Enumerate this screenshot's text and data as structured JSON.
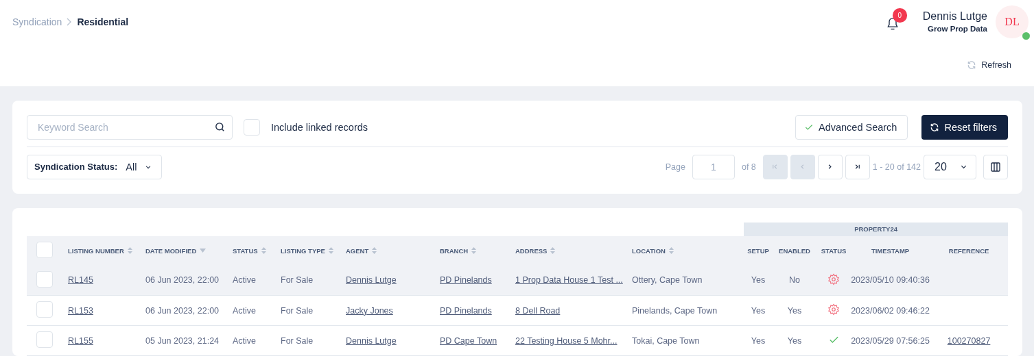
{
  "breadcrumb": [
    {
      "label": "Syndication",
      "current": false
    },
    {
      "label": "Residential",
      "current": true
    }
  ],
  "notifications": {
    "count": "0"
  },
  "user": {
    "name": "Dennis Lutge",
    "company": "Grow Prop Data",
    "initials": "DL",
    "online": true
  },
  "refresh": {
    "label": "Refresh"
  },
  "filters": {
    "search": {
      "placeholder": "Keyword Search"
    },
    "linked": {
      "label": "Include linked records",
      "checked": false
    },
    "advanced": {
      "label": "Advanced Search",
      "active": true
    },
    "reset": {
      "label": "Reset filters"
    },
    "status_filter": {
      "label": "Syndication Status:",
      "value": "All"
    }
  },
  "pagination": {
    "page_label": "Page",
    "page": "1",
    "of": "of 8",
    "buttons": [
      {
        "kind": "first",
        "disabled": true
      },
      {
        "kind": "prev",
        "disabled": true
      },
      {
        "kind": "next",
        "disabled": false
      },
      {
        "kind": "last",
        "disabled": false
      }
    ],
    "range": "1 - 20 of 142",
    "per_page": "20"
  },
  "table": {
    "group_header": "PROPERTY24",
    "all_checked": false,
    "columns": [
      {
        "label": "LISTING NUMBER",
        "sortable": true,
        "sorted": false
      },
      {
        "label": "DATE MODIFIED",
        "sortable": true,
        "sorted": true
      },
      {
        "label": "STATUS",
        "sortable": true,
        "sorted": false
      },
      {
        "label": "LISTING TYPE",
        "sortable": true,
        "sorted": false
      },
      {
        "label": "AGENT",
        "sortable": true,
        "sorted": false
      },
      {
        "label": "BRANCH",
        "sortable": true,
        "sorted": false
      },
      {
        "label": "ADDRESS",
        "sortable": true,
        "sorted": false
      },
      {
        "label": "LOCATION",
        "sortable": true,
        "sorted": false
      },
      {
        "label": "SETUP",
        "sortable": false
      },
      {
        "label": "ENABLED",
        "sortable": false
      },
      {
        "label": "STATUS",
        "sortable": false
      },
      {
        "label": "TIMESTAMP",
        "sortable": false
      },
      {
        "label": "REFERENCE",
        "sortable": false
      }
    ],
    "rows": [
      {
        "highlighted": true,
        "checked": false,
        "listing": "RL145",
        "date": "06 Jun 2023, 22:00",
        "status": "Active",
        "type": "For Sale",
        "agent": "Dennis Lutge",
        "branch": "PD Pinelands",
        "address": "1 Prop Data House 1 Test ...",
        "location": "Ottery, Cape Town",
        "setup": "Yes",
        "enabled": "No",
        "synced": false,
        "timestamp": "2023/05/10 09:40:36"
      },
      {
        "highlighted": false,
        "checked": false,
        "listing": "RL153",
        "date": "06 Jun 2023, 22:00",
        "status": "Active",
        "type": "For Sale",
        "agent": "Jacky Jones",
        "branch": "PD Pinelands",
        "address": "8 Dell Road",
        "location": "Pinelands, Cape Town",
        "setup": "Yes",
        "enabled": "Yes",
        "synced": false,
        "timestamp": "2023/06/02 09:46:22"
      },
      {
        "highlighted": false,
        "checked": false,
        "listing": "RL155",
        "date": "05 Jun 2023, 21:24",
        "status": "Active",
        "type": "For Sale",
        "agent": "Dennis Lutge",
        "branch": "PD Cape Town",
        "address": "22 Testing House 5 Mohr...",
        "location": "Tokai, Cape Town",
        "setup": "Yes",
        "enabled": "Yes",
        "synced": true,
        "timestamp": "2023/05/29 07:56:25",
        "reference": "100270827"
      }
    ]
  }
}
